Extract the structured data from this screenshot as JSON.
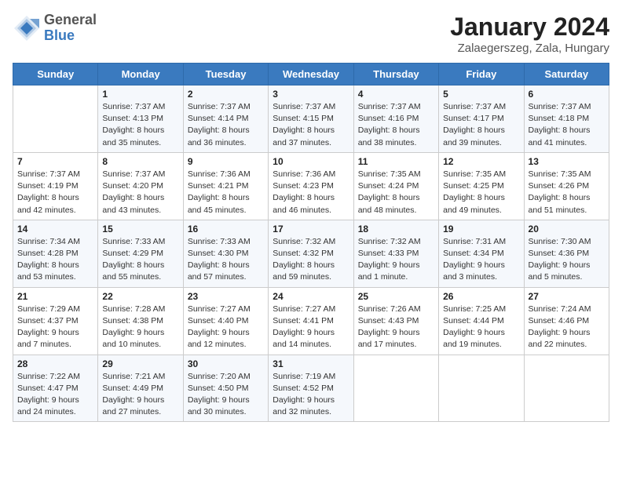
{
  "header": {
    "logo": {
      "line1": "General",
      "line2": "Blue"
    },
    "title": "January 2024",
    "subtitle": "Zalaegerszeg, Zala, Hungary"
  },
  "weekdays": [
    "Sunday",
    "Monday",
    "Tuesday",
    "Wednesday",
    "Thursday",
    "Friday",
    "Saturday"
  ],
  "weeks": [
    [
      {
        "day": "",
        "sunrise": "",
        "sunset": "",
        "daylight": ""
      },
      {
        "day": "1",
        "sunrise": "Sunrise: 7:37 AM",
        "sunset": "Sunset: 4:13 PM",
        "daylight": "Daylight: 8 hours and 35 minutes."
      },
      {
        "day": "2",
        "sunrise": "Sunrise: 7:37 AM",
        "sunset": "Sunset: 4:14 PM",
        "daylight": "Daylight: 8 hours and 36 minutes."
      },
      {
        "day": "3",
        "sunrise": "Sunrise: 7:37 AM",
        "sunset": "Sunset: 4:15 PM",
        "daylight": "Daylight: 8 hours and 37 minutes."
      },
      {
        "day": "4",
        "sunrise": "Sunrise: 7:37 AM",
        "sunset": "Sunset: 4:16 PM",
        "daylight": "Daylight: 8 hours and 38 minutes."
      },
      {
        "day": "5",
        "sunrise": "Sunrise: 7:37 AM",
        "sunset": "Sunset: 4:17 PM",
        "daylight": "Daylight: 8 hours and 39 minutes."
      },
      {
        "day": "6",
        "sunrise": "Sunrise: 7:37 AM",
        "sunset": "Sunset: 4:18 PM",
        "daylight": "Daylight: 8 hours and 41 minutes."
      }
    ],
    [
      {
        "day": "7",
        "sunrise": "Sunrise: 7:37 AM",
        "sunset": "Sunset: 4:19 PM",
        "daylight": "Daylight: 8 hours and 42 minutes."
      },
      {
        "day": "8",
        "sunrise": "Sunrise: 7:37 AM",
        "sunset": "Sunset: 4:20 PM",
        "daylight": "Daylight: 8 hours and 43 minutes."
      },
      {
        "day": "9",
        "sunrise": "Sunrise: 7:36 AM",
        "sunset": "Sunset: 4:21 PM",
        "daylight": "Daylight: 8 hours and 45 minutes."
      },
      {
        "day": "10",
        "sunrise": "Sunrise: 7:36 AM",
        "sunset": "Sunset: 4:23 PM",
        "daylight": "Daylight: 8 hours and 46 minutes."
      },
      {
        "day": "11",
        "sunrise": "Sunrise: 7:35 AM",
        "sunset": "Sunset: 4:24 PM",
        "daylight": "Daylight: 8 hours and 48 minutes."
      },
      {
        "day": "12",
        "sunrise": "Sunrise: 7:35 AM",
        "sunset": "Sunset: 4:25 PM",
        "daylight": "Daylight: 8 hours and 49 minutes."
      },
      {
        "day": "13",
        "sunrise": "Sunrise: 7:35 AM",
        "sunset": "Sunset: 4:26 PM",
        "daylight": "Daylight: 8 hours and 51 minutes."
      }
    ],
    [
      {
        "day": "14",
        "sunrise": "Sunrise: 7:34 AM",
        "sunset": "Sunset: 4:28 PM",
        "daylight": "Daylight: 8 hours and 53 minutes."
      },
      {
        "day": "15",
        "sunrise": "Sunrise: 7:33 AM",
        "sunset": "Sunset: 4:29 PM",
        "daylight": "Daylight: 8 hours and 55 minutes."
      },
      {
        "day": "16",
        "sunrise": "Sunrise: 7:33 AM",
        "sunset": "Sunset: 4:30 PM",
        "daylight": "Daylight: 8 hours and 57 minutes."
      },
      {
        "day": "17",
        "sunrise": "Sunrise: 7:32 AM",
        "sunset": "Sunset: 4:32 PM",
        "daylight": "Daylight: 8 hours and 59 minutes."
      },
      {
        "day": "18",
        "sunrise": "Sunrise: 7:32 AM",
        "sunset": "Sunset: 4:33 PM",
        "daylight": "Daylight: 9 hours and 1 minute."
      },
      {
        "day": "19",
        "sunrise": "Sunrise: 7:31 AM",
        "sunset": "Sunset: 4:34 PM",
        "daylight": "Daylight: 9 hours and 3 minutes."
      },
      {
        "day": "20",
        "sunrise": "Sunrise: 7:30 AM",
        "sunset": "Sunset: 4:36 PM",
        "daylight": "Daylight: 9 hours and 5 minutes."
      }
    ],
    [
      {
        "day": "21",
        "sunrise": "Sunrise: 7:29 AM",
        "sunset": "Sunset: 4:37 PM",
        "daylight": "Daylight: 9 hours and 7 minutes."
      },
      {
        "day": "22",
        "sunrise": "Sunrise: 7:28 AM",
        "sunset": "Sunset: 4:38 PM",
        "daylight": "Daylight: 9 hours and 10 minutes."
      },
      {
        "day": "23",
        "sunrise": "Sunrise: 7:27 AM",
        "sunset": "Sunset: 4:40 PM",
        "daylight": "Daylight: 9 hours and 12 minutes."
      },
      {
        "day": "24",
        "sunrise": "Sunrise: 7:27 AM",
        "sunset": "Sunset: 4:41 PM",
        "daylight": "Daylight: 9 hours and 14 minutes."
      },
      {
        "day": "25",
        "sunrise": "Sunrise: 7:26 AM",
        "sunset": "Sunset: 4:43 PM",
        "daylight": "Daylight: 9 hours and 17 minutes."
      },
      {
        "day": "26",
        "sunrise": "Sunrise: 7:25 AM",
        "sunset": "Sunset: 4:44 PM",
        "daylight": "Daylight: 9 hours and 19 minutes."
      },
      {
        "day": "27",
        "sunrise": "Sunrise: 7:24 AM",
        "sunset": "Sunset: 4:46 PM",
        "daylight": "Daylight: 9 hours and 22 minutes."
      }
    ],
    [
      {
        "day": "28",
        "sunrise": "Sunrise: 7:22 AM",
        "sunset": "Sunset: 4:47 PM",
        "daylight": "Daylight: 9 hours and 24 minutes."
      },
      {
        "day": "29",
        "sunrise": "Sunrise: 7:21 AM",
        "sunset": "Sunset: 4:49 PM",
        "daylight": "Daylight: 9 hours and 27 minutes."
      },
      {
        "day": "30",
        "sunrise": "Sunrise: 7:20 AM",
        "sunset": "Sunset: 4:50 PM",
        "daylight": "Daylight: 9 hours and 30 minutes."
      },
      {
        "day": "31",
        "sunrise": "Sunrise: 7:19 AM",
        "sunset": "Sunset: 4:52 PM",
        "daylight": "Daylight: 9 hours and 32 minutes."
      },
      {
        "day": "",
        "sunrise": "",
        "sunset": "",
        "daylight": ""
      },
      {
        "day": "",
        "sunrise": "",
        "sunset": "",
        "daylight": ""
      },
      {
        "day": "",
        "sunrise": "",
        "sunset": "",
        "daylight": ""
      }
    ]
  ]
}
